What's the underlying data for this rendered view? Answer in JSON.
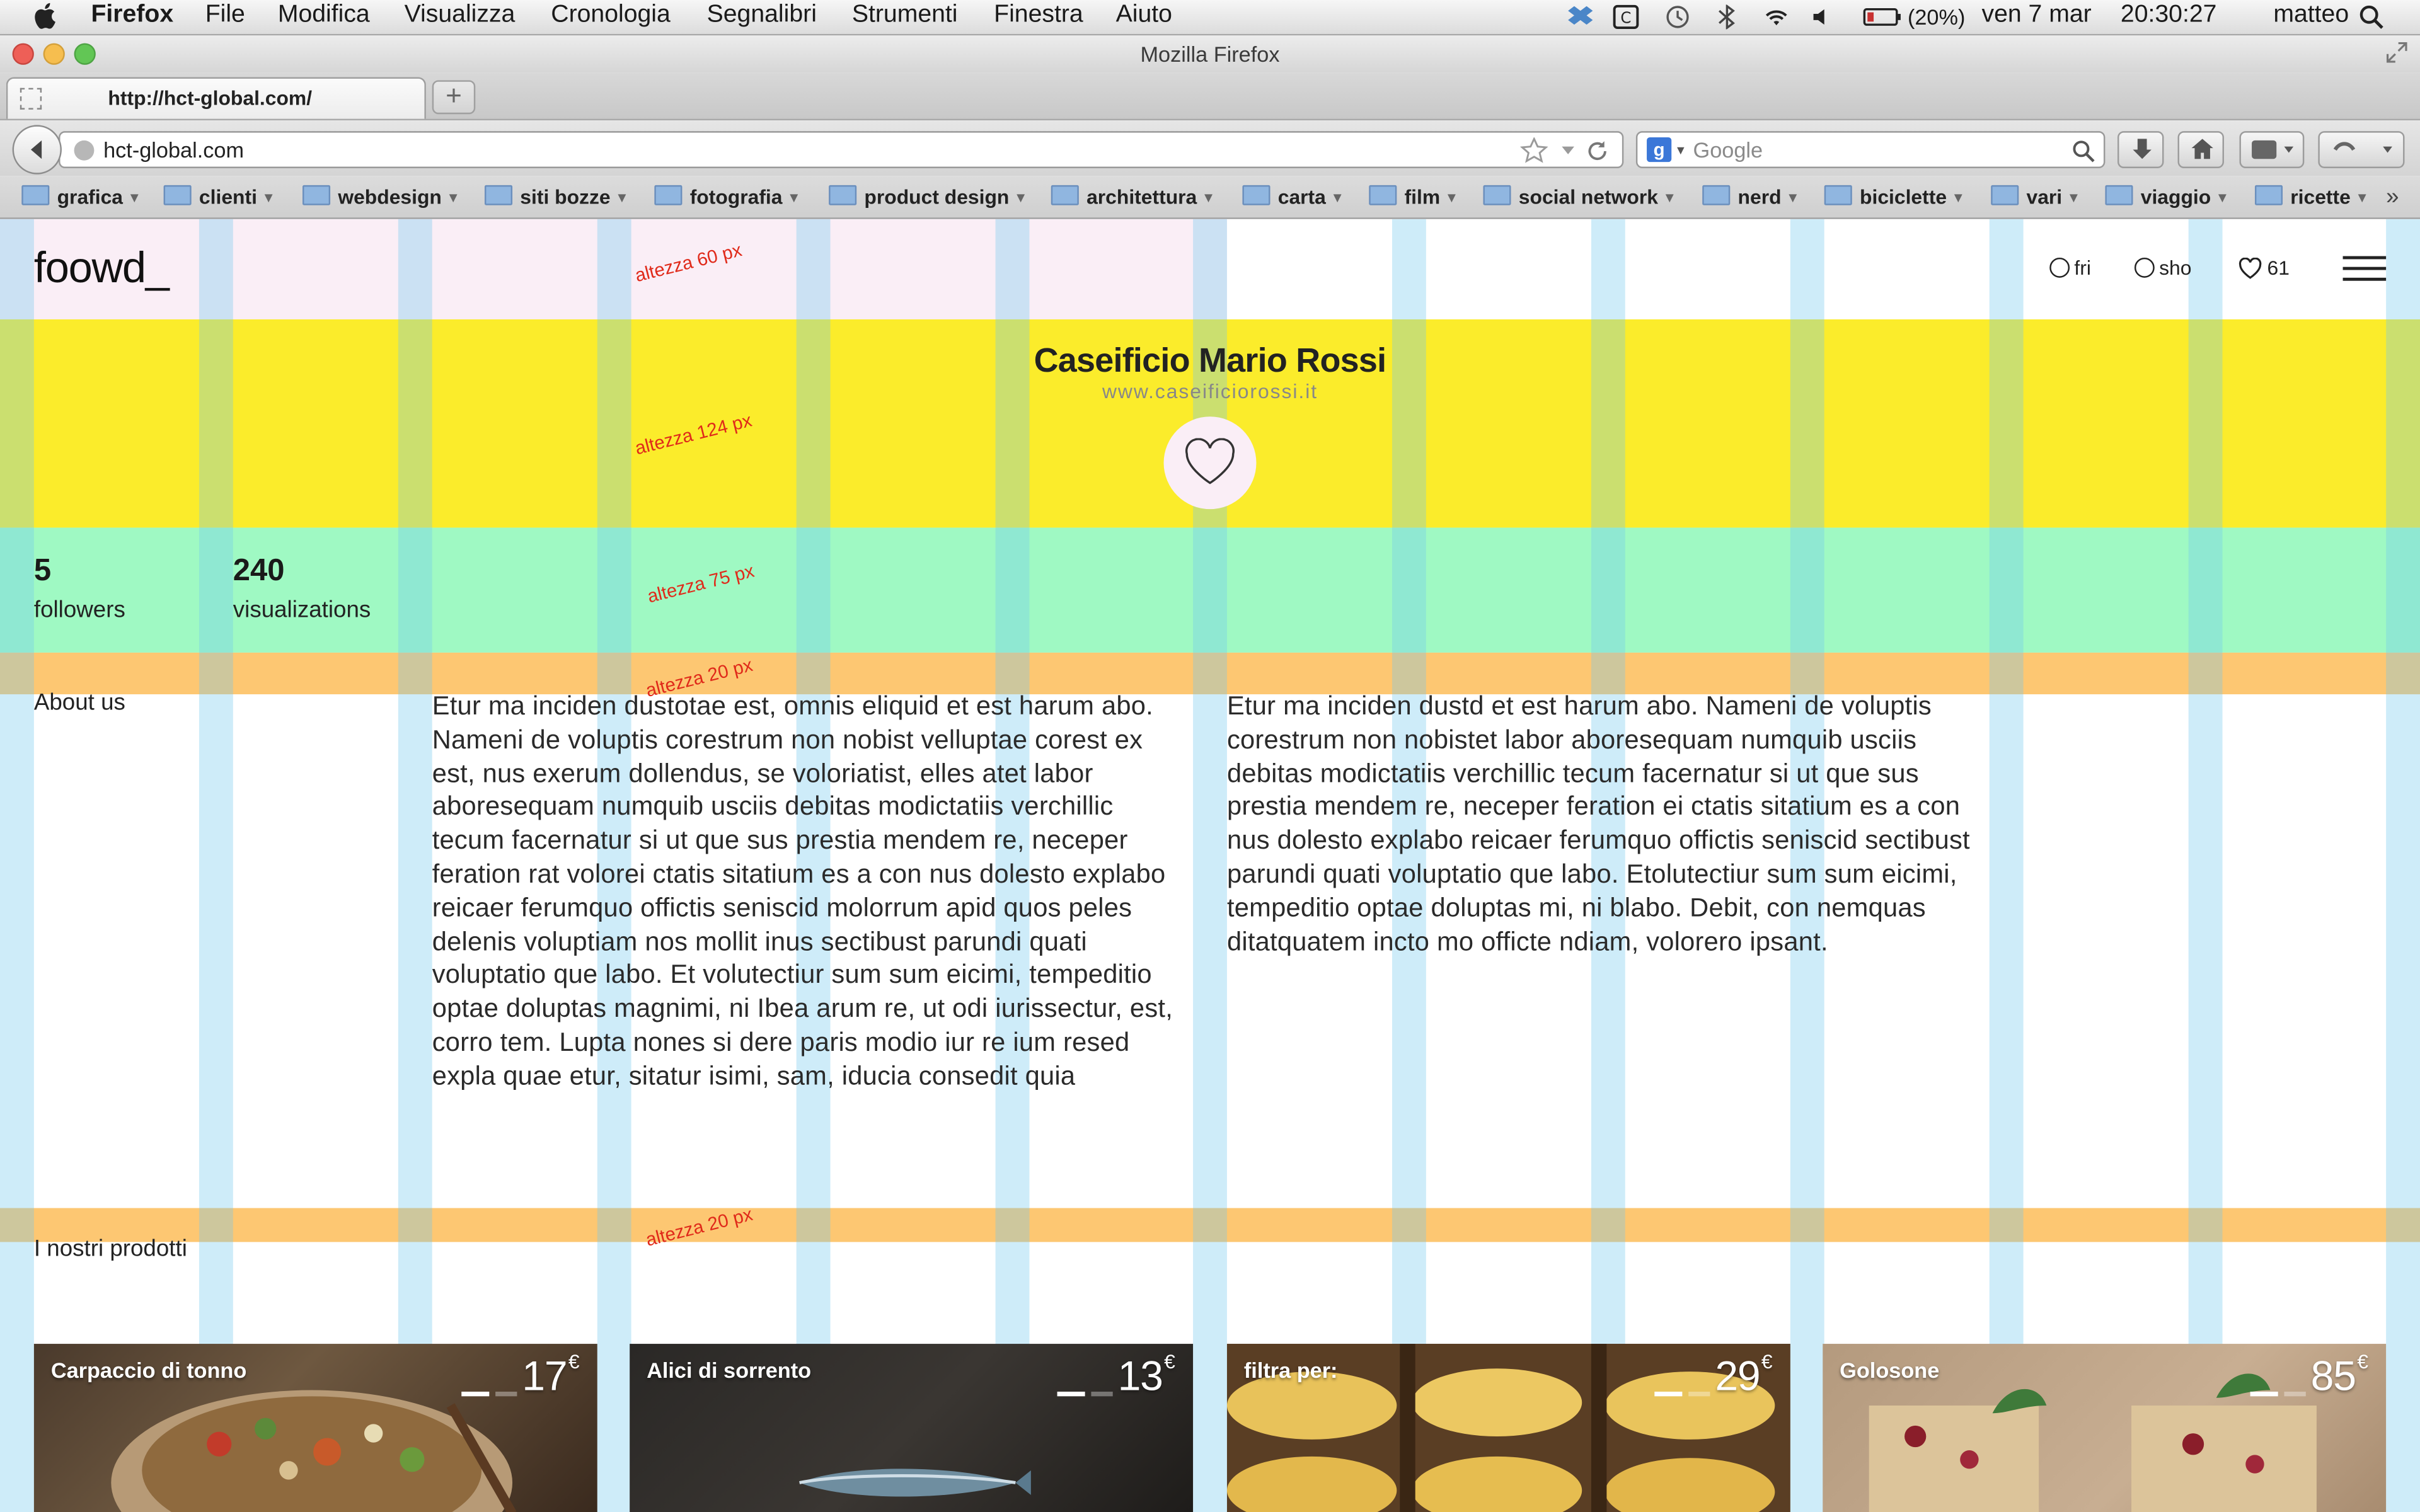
{
  "menubar": {
    "items": [
      "Firefox",
      "File",
      "Modifica",
      "Visualizza",
      "Cronologia",
      "Segnalibri",
      "Strumenti",
      "Finestra",
      "Aiuto"
    ],
    "battery": "(20%)",
    "date": "ven 7 mar",
    "time": "20:30:27",
    "user": "matteo"
  },
  "window": {
    "title": "Mozilla Firefox"
  },
  "tab": {
    "label": "http://hct-global.com/"
  },
  "navbar": {
    "url": "hct-global.com",
    "search_placeholder": "Google"
  },
  "bookmarks": [
    "grafica",
    "clienti",
    "webdesign",
    "siti bozze",
    "fotografia",
    "product design",
    "architettura",
    "carta",
    "film",
    "social network",
    "nerd",
    "biciclette",
    "vari",
    "viaggio",
    "ricette"
  ],
  "header": {
    "logo": "foowd_",
    "nav": [
      {
        "label": "fri",
        "icon": "circle-icon"
      },
      {
        "label": "sho",
        "icon": "circle-icon"
      },
      {
        "label": "61",
        "icon": "heart-icon"
      }
    ]
  },
  "business": {
    "name": "Caseificio Mario Rossi",
    "website": "www.caseificiorossi.it"
  },
  "stats": [
    {
      "value": "5",
      "label": "followers"
    },
    {
      "value": "240",
      "label": "visualizations"
    }
  ],
  "annotations": [
    "altezza 60 px",
    "altezza 124 px",
    "altezza 75 px",
    "altezza 20 px",
    "altezza 20 px"
  ],
  "about": {
    "title": "About us",
    "text1": "Etur ma inciden dustotae est, omnis eliquid et est harum abo. Nameni de voluptis corestrum non nobist velluptae corest ex est, nus exerum dollendus, se voloriatist, elles atet labor aboresequam numquib usciis debitas modictatiis verchillic tecum facernatur si ut que sus prestia mendem re, neceper feration rat volorei ctatis sitatium es a con nus dolesto explabo reicaer ferumquo offictis seniscid molorrum apid quos peles delenis voluptiam nos mollit inus sectibust parundi quati voluptatio que labo. Et volutectiur sum sum eicimi, tempeditio optae doluptas magnimi, ni Ibea arum re, ut odi iurissectur, est, corro tem. Lupta nones si dere paris modio iur re ium resed expla quae etur, sitatur isimi, sam, iducia consedit quia",
    "text2": "Etur ma inciden dustd et est harum abo. Nameni de voluptis corestrum non nobistet labor aboresequam numquib usciis debitas modictatiis verchillic tecum facernatur si ut que sus prestia mendem re, neceper feration ei ctatis sitatium es a con nus dolesto explabo reicaer ferumquo offictis seniscid sectibust parundi quati voluptatio que labo. Etolutectiur sum sum eicimi, tempeditio optae doluptas mi, ni blabo. Debit, con nemquas ditatquatem incto mo officte ndiam, volorero ipsant."
  },
  "products": {
    "title": "I nostri prodotti",
    "items": [
      {
        "name": "Carpaccio di tonno",
        "price": "17",
        "currency": "€"
      },
      {
        "name": "Alici di sorrento",
        "price": "13",
        "currency": "€"
      },
      {
        "name": "filtra per:",
        "price": "29",
        "currency": "€"
      },
      {
        "name": "Golosone",
        "price": "85",
        "currency": "€"
      }
    ]
  },
  "colors": {
    "header_pink": "#faeef6",
    "yellow_band": "#fbec2b",
    "green_band": "#9ff9c3",
    "orange_band": "#fdc772",
    "grid_blue": "#73c8ee",
    "annotation_red": "#e02a1a"
  }
}
